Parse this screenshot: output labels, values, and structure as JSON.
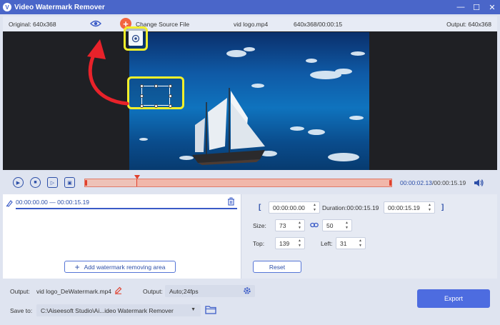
{
  "window": {
    "title": "Video Watermark Remover"
  },
  "infobar": {
    "original": "Original: 640x368",
    "change_source": "Change Source File",
    "file_name": "vid logo.mp4",
    "file_meta": "640x368/00:00:15",
    "output": "Output: 640x368"
  },
  "player": {
    "current_time": "00:00:02.13",
    "total_time": "/00:00:15.19"
  },
  "segments": [
    {
      "range": "00:00:00.00 — 00:00:15.19"
    }
  ],
  "left_panel": {
    "add_area_label": "Add watermark removing area"
  },
  "right_panel": {
    "start_time": "00:00:00.00",
    "duration_label": "Duration:00:00:15.19",
    "end_time": "00:00:15.19",
    "bracket_open": "[",
    "bracket_close": "]",
    "size_label": "Size:",
    "width": "73",
    "height": "50",
    "top_label": "Top:",
    "top": "139",
    "left_label": "Left:",
    "left": "31",
    "reset_label": "Reset"
  },
  "footer": {
    "output_label": "Output:",
    "output_file": "vid logo_DeWatermark.mp4",
    "output_format_label": "Output:",
    "output_format": "Auto;24fps",
    "save_to_label": "Save to:",
    "save_path": "C:\\Aiseesoft Studio\\Ai...ideo Watermark Remover",
    "export_label": "Export"
  },
  "colors": {
    "accent": "#4a66c9",
    "highlight": "#f3f02a",
    "arrow": "#e8222a",
    "timeline": "#f1b7aa"
  }
}
